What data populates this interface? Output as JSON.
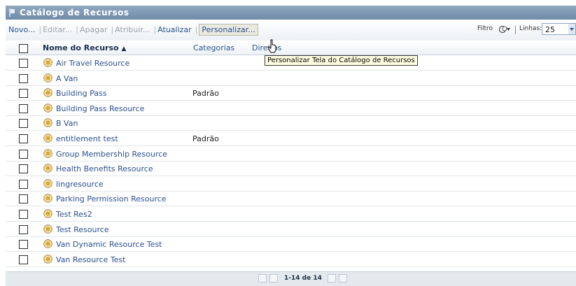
{
  "title": "Catálogo de Recursos",
  "toolbar": {
    "actions": [
      {
        "label": "Novo...",
        "state": "enabled"
      },
      {
        "label": "Editar...",
        "state": "disabled"
      },
      {
        "label": "Apagar",
        "state": "disabled"
      },
      {
        "label": "Atribuir...",
        "state": "disabled"
      },
      {
        "label": "Atualizar",
        "state": "enabled"
      },
      {
        "label": "Personalizar...",
        "state": "hover"
      }
    ],
    "filter_label": "Filtro",
    "lines_label": "Linhas:",
    "lines_value": "25"
  },
  "columns": {
    "name": "Nome do Recurso",
    "sort_indicator": "▲",
    "categories": "Categorias",
    "rights": "Direitos"
  },
  "rows": [
    {
      "name": "Air Travel Resource",
      "category": ""
    },
    {
      "name": "A Van",
      "category": ""
    },
    {
      "name": "Building Pass",
      "category": "Padrão"
    },
    {
      "name": "Building Pass Resource",
      "category": ""
    },
    {
      "name": "B Van",
      "category": ""
    },
    {
      "name": "entitlement test",
      "category": "Padrão"
    },
    {
      "name": "Group Membership Resource",
      "category": ""
    },
    {
      "name": "Health Benefits Resource",
      "category": ""
    },
    {
      "name": "lingresource",
      "category": ""
    },
    {
      "name": "Parking Permission Resource",
      "category": ""
    },
    {
      "name": "Test Res2",
      "category": ""
    },
    {
      "name": "Test Resource",
      "category": ""
    },
    {
      "name": "Van Dynamic Resource Test",
      "category": ""
    },
    {
      "name": "Van Resource Test",
      "category": ""
    }
  ],
  "pagination": {
    "text": "1-14 de 14"
  },
  "tooltip": "Personalizar Tela do Catálogo de Recursos",
  "colors": {
    "title_bar": "#7d96b2",
    "link": "#2a5090",
    "tooltip_bg": "#ffffe1"
  }
}
